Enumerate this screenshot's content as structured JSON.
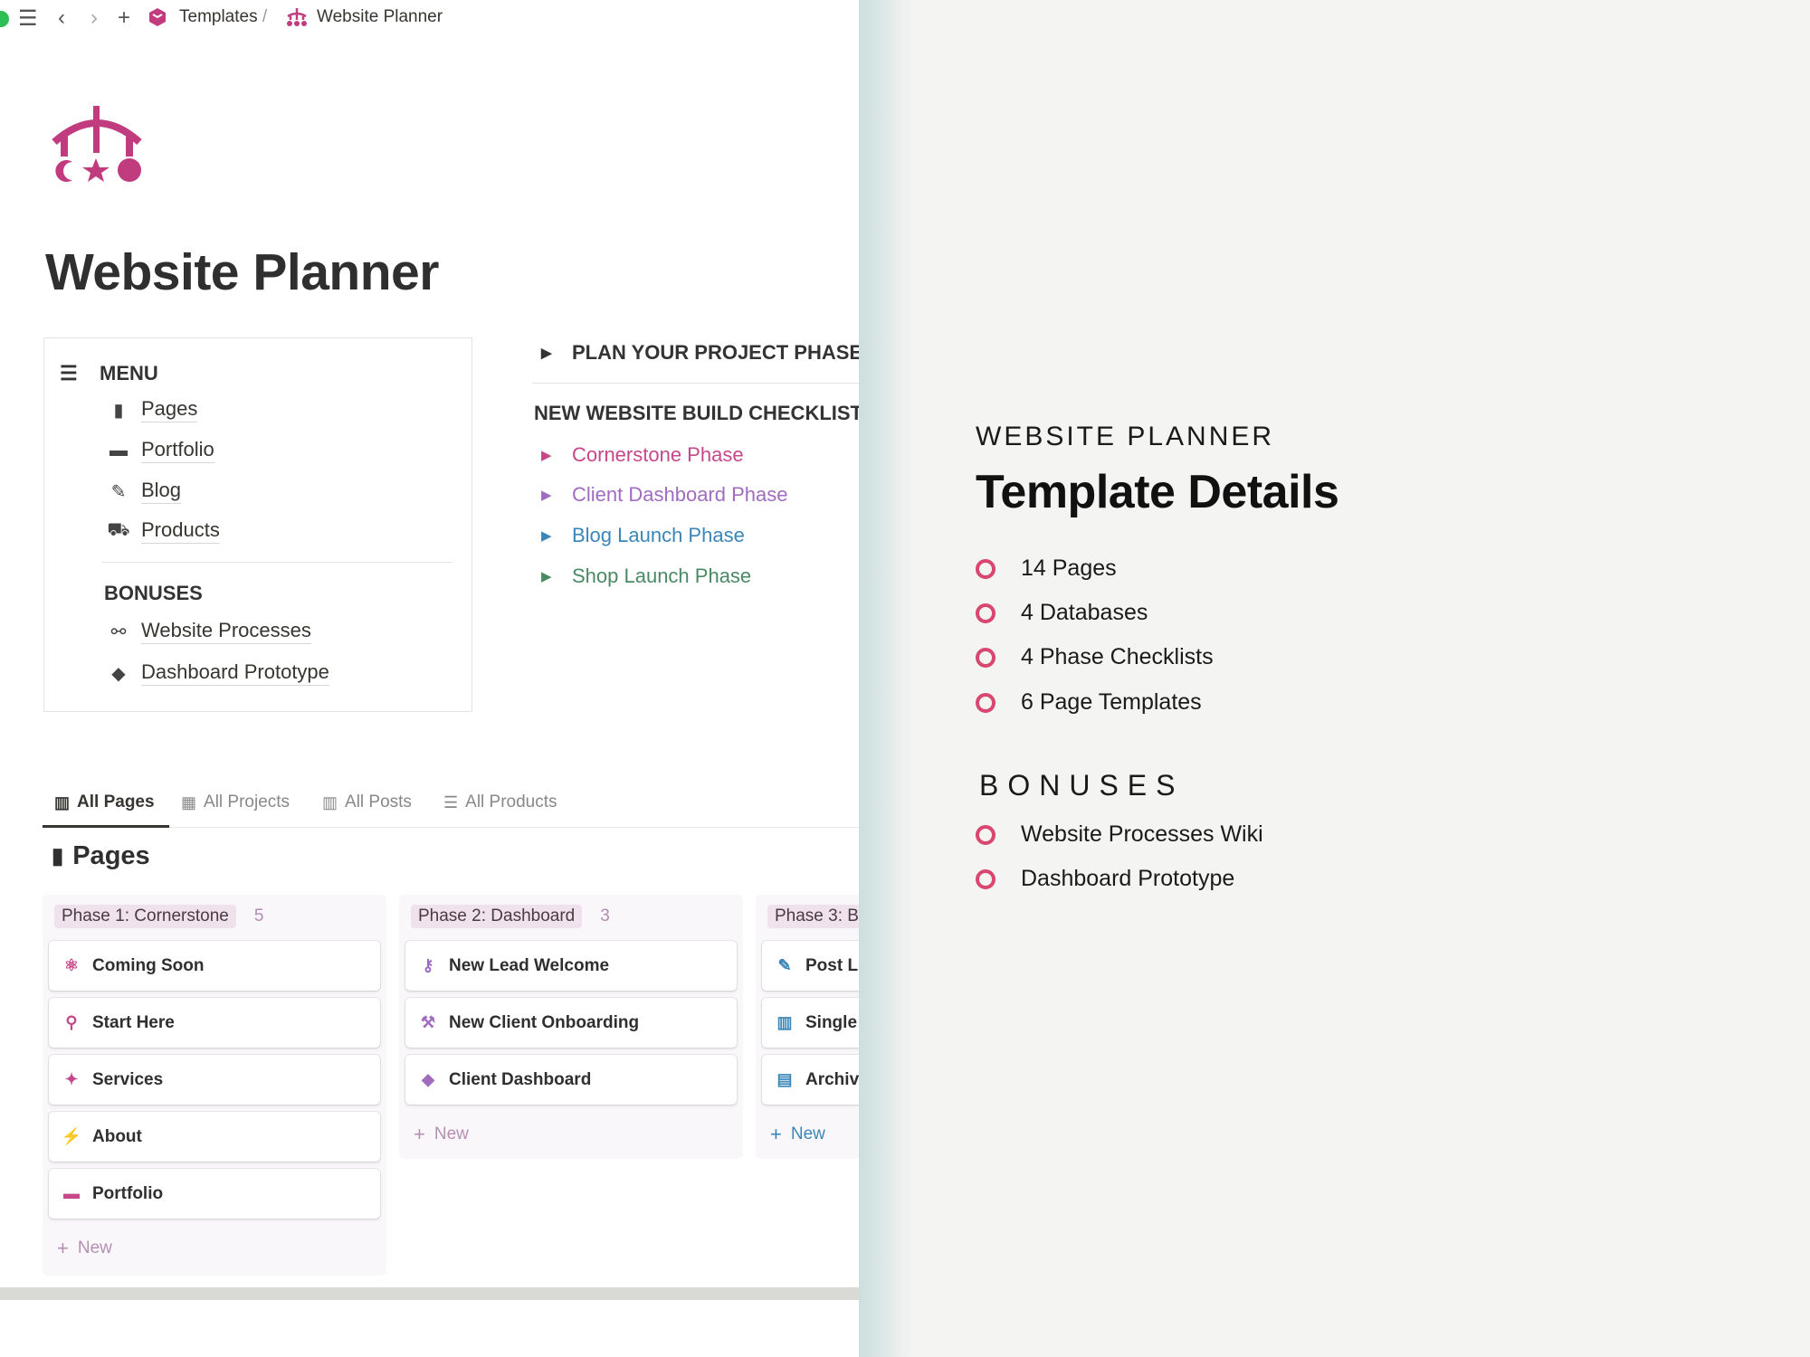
{
  "topbar": {
    "crumbs": [
      "Templates",
      "Website Planner"
    ],
    "separator": "/"
  },
  "page": {
    "title": "Website Planner",
    "brand_color": "#c13b7f"
  },
  "menu": {
    "heading": "MENU",
    "items": [
      {
        "label": "Pages",
        "icon": "pages-icon"
      },
      {
        "label": "Portfolio",
        "icon": "briefcase-icon"
      },
      {
        "label": "Blog",
        "icon": "edit-icon"
      },
      {
        "label": "Products",
        "icon": "cart-icon"
      }
    ],
    "bonus_heading": "BONUSES",
    "bonuses": [
      {
        "label": "Website Processes",
        "icon": "flow-icon"
      },
      {
        "label": "Dashboard Prototype",
        "icon": "gem-icon"
      }
    ]
  },
  "toggles": {
    "plan": "PLAN YOUR PROJECT PHASES",
    "checklist_heading": "NEW WEBSITE BUILD CHECKLIST",
    "phases": [
      {
        "label": "Cornerstone Phase",
        "color": "#c6478a"
      },
      {
        "label": "Client Dashboard Phase",
        "color": "#a06cc0"
      },
      {
        "label": "Blog Launch Phase",
        "color": "#3b86b8"
      },
      {
        "label": "Shop Launch Phase",
        "color": "#4a8a63"
      }
    ]
  },
  "tabs": [
    {
      "label": "All Pages",
      "icon": "board-icon",
      "active": true
    },
    {
      "label": "All Projects",
      "icon": "gallery-icon",
      "active": false
    },
    {
      "label": "All Posts",
      "icon": "board-icon",
      "active": false
    },
    {
      "label": "All Products",
      "icon": "list-icon",
      "active": false
    }
  ],
  "database": {
    "title": "Pages",
    "new_label": "New",
    "columns": [
      {
        "tag": "Phase 1: Cornerstone",
        "count": "5",
        "cards": [
          {
            "label": "Coming Soon",
            "icon": "atom-icon"
          },
          {
            "label": "Start Here",
            "icon": "pin-icon"
          },
          {
            "label": "Services",
            "icon": "sparkle-icon"
          },
          {
            "label": "About",
            "icon": "wand-icon"
          },
          {
            "label": "Portfolio",
            "icon": "briefcase-icon"
          }
        ]
      },
      {
        "tag": "Phase 2: Dashboard",
        "count": "3",
        "cards": [
          {
            "label": "New Lead Welcome",
            "icon": "key-icon"
          },
          {
            "label": "New Client Onboarding",
            "icon": "wrench-icon"
          },
          {
            "label": "Client Dashboard",
            "icon": "gem-icon"
          }
        ]
      },
      {
        "tag": "Phase 3: B",
        "count": "",
        "cards": [
          {
            "label": "Post L",
            "icon": "edit-icon"
          },
          {
            "label": "Single",
            "icon": "columns-icon"
          },
          {
            "label": "Archiv",
            "icon": "archive-icon"
          }
        ]
      }
    ]
  },
  "details": {
    "eyebrow": "WEBSITE PLANNER",
    "title": "Template Details",
    "items": [
      "14 Pages",
      "4 Databases",
      "4 Phase Checklists",
      "6 Page Templates"
    ],
    "bonus_heading": "BONUSES",
    "bonuses": [
      "Website Processes Wiki",
      "Dashboard Prototype"
    ],
    "bullet_color": "#d9466f"
  }
}
